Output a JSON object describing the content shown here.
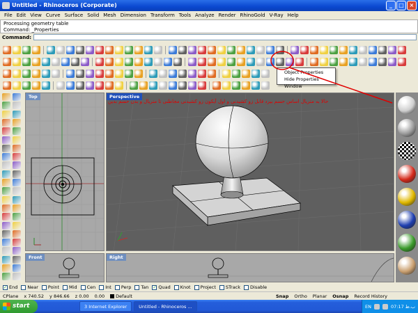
{
  "window": {
    "title": "Untitled - Rhinoceros (Corporate)",
    "controls": [
      "_",
      "□",
      "×"
    ]
  },
  "menu": [
    "File",
    "Edit",
    "View",
    "Curve",
    "Surface",
    "Solid",
    "Mesh",
    "Dimension",
    "Transform",
    "Tools",
    "Analyze",
    "Render",
    "RhinoGold",
    "V-Ray",
    "Help"
  ],
  "command_history": [
    "Processing geometry table",
    "Command: _Properties"
  ],
  "command_label": "Command:",
  "popup": {
    "items": [
      "Object Properties",
      "Hide Properties Window"
    ]
  },
  "annotation_text": "حالا به متریال اساس حسم بیرد قابل زو کشیدنی و اول آیکون زو کشیدنی مجاطنی تا متریال و بدن حسم بدین",
  "viewports": {
    "top": "Top",
    "perspective": "Perspective",
    "front": "Front",
    "right": "Right"
  },
  "osnap": {
    "items": [
      {
        "label": "End",
        "checked": true
      },
      {
        "label": "Near",
        "checked": false
      },
      {
        "label": "Point",
        "checked": false
      },
      {
        "label": "Mid",
        "checked": false
      },
      {
        "label": "Cen",
        "checked": false
      },
      {
        "label": "Int",
        "checked": false
      },
      {
        "label": "Perp",
        "checked": false
      },
      {
        "label": "Tan",
        "checked": false
      },
      {
        "label": "Quad",
        "checked": true
      },
      {
        "label": "Knot",
        "checked": false
      },
      {
        "label": "Project",
        "checked": false
      },
      {
        "label": "STrack",
        "checked": false
      },
      {
        "label": "Disable",
        "checked": false
      }
    ]
  },
  "status": {
    "plane": "CPlane",
    "x": "x 740.52",
    "y": "y 846.66",
    "z": "z 0.00",
    "dist": "0.00",
    "layer": "Default",
    "toggles": [
      "Snap",
      "Ortho",
      "Planar",
      "Osnap",
      "Record History"
    ]
  },
  "taskbar": {
    "start": "start",
    "tasks": [
      "3 Internet Explorer",
      "Untitled - Rhinoceros ..."
    ],
    "lang": "EN",
    "clock": "07:17 ب.ظ"
  },
  "colors": {
    "title_bar": "#0a48d0",
    "annotation": "#e00000",
    "active_viewport_tab": "#2050b8",
    "viewport_tab": "#6f8fbf"
  },
  "materials": [
    "#cfcfcf",
    "#9a9a9a",
    "checker",
    "#d42a1a",
    "#e0b800",
    "#1f3fb0",
    "#3a9a2a",
    "#caa070"
  ]
}
